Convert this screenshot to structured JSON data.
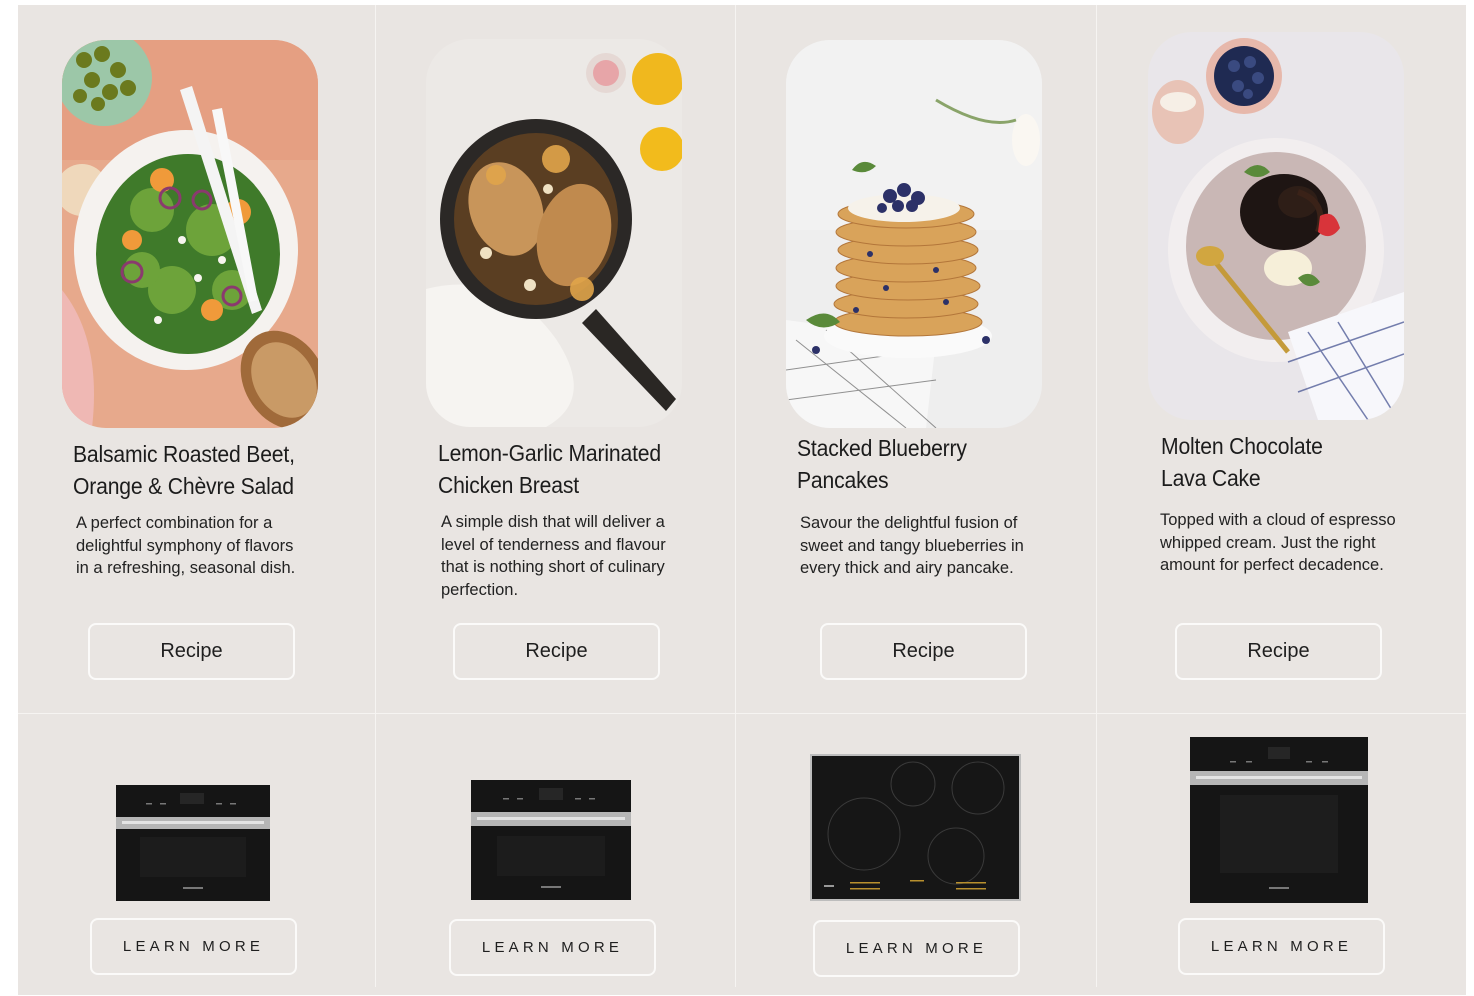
{
  "recipes": [
    {
      "title_line1": "Balsamic Roasted Beet,",
      "title_line2": "Orange & Chèvre Salad",
      "description": "A perfect combination for a delightful symphony of flavors in a refreshing, seasonal dish.",
      "button_label": "Recipe"
    },
    {
      "title_line1": "Lemon-Garlic Marinated",
      "title_line2": "Chicken Breast",
      "description": "A simple dish that will deliver a level of tenderness and flavour that is nothing short of culinary perfection.",
      "button_label": "Recipe"
    },
    {
      "title_line1": "Stacked Blueberry",
      "title_line2": "Pancakes",
      "description": "Savour the delightful fusion of sweet and tangy blueberries in every thick and airy pancake.",
      "button_label": "Recipe"
    },
    {
      "title_line1": "Molten Chocolate",
      "title_line2": "Lava Cake",
      "description": "Topped with a cloud of espresso whipped cream. Just the right amount for perfect decadence.",
      "button_label": "Recipe"
    }
  ],
  "products": [
    {
      "button_label": "LEARN MORE",
      "type": "combi-steam-oven"
    },
    {
      "button_label": "LEARN MORE",
      "type": "speed-oven"
    },
    {
      "button_label": "LEARN MORE",
      "type": "induction-cooktop"
    },
    {
      "button_label": "LEARN MORE",
      "type": "wall-oven"
    }
  ],
  "colors": {
    "background": "#e9e5e2",
    "divider": "#f6f4f2",
    "button_border": "#fbfaf9",
    "appliance_black": "#151515"
  }
}
